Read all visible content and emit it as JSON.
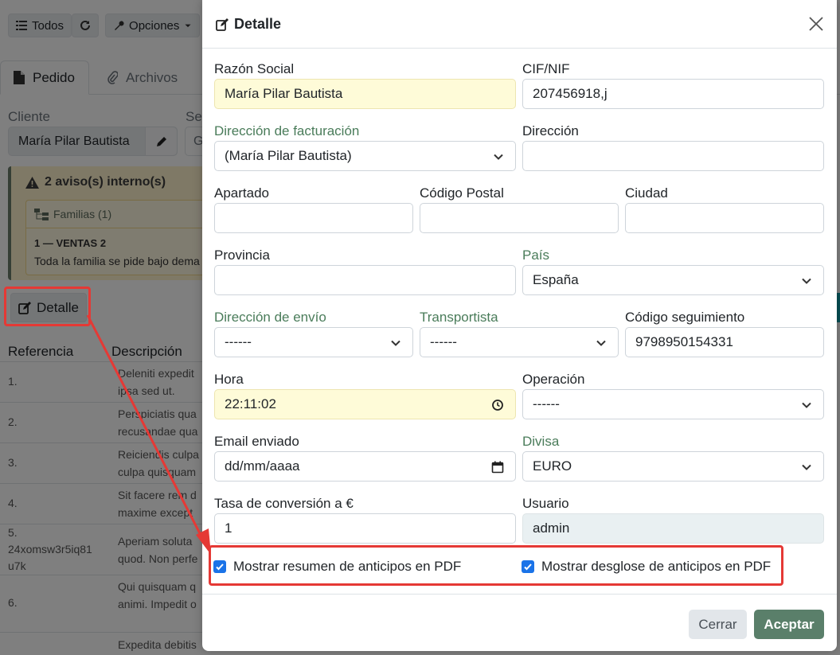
{
  "background": {
    "toolbar": {
      "todos_label": "Todos",
      "opciones_label": "Opciones"
    },
    "tabs": [
      {
        "label": "Pedido"
      },
      {
        "label": "Archivos"
      }
    ],
    "cliente_label": "Cliente",
    "cliente_value": "María Pilar Bautista",
    "se_label": "Se",
    "se_value": "G",
    "alert": {
      "title": "2 aviso(s) interno(s)",
      "familias": "Familias (1)",
      "item": "1 — VENTAS 2",
      "text": "Toda la familia se pide bajo dema"
    },
    "detalle_button": "Detalle",
    "table": {
      "headers": [
        "Referencia",
        "Descripción"
      ],
      "rows": [
        {
          "num": "1.",
          "desc_l1": "Deleniti expedit",
          "desc_l2": "ipsa sed ut."
        },
        {
          "num": "2.",
          "desc_l1": "Perspiciatis qua",
          "desc_l2": "recusandae qua"
        },
        {
          "num": "3.",
          "desc_l1": "Reiciendis culpa",
          "desc_l2": "culpa quisquam"
        },
        {
          "num": "4.",
          "desc_l1": "Sit facere rem d",
          "desc_l2": "maxime except"
        },
        {
          "num": "5.",
          "ref_l2": "24xomsw3r5iq81",
          "ref_l3": "u7k",
          "desc_l1": "Aperiam soluta",
          "desc_l2": "quod. Non perfe"
        },
        {
          "num": "6.",
          "desc_l1": "Qui quisquam q",
          "desc_l2": "animi. Impedit o"
        },
        {
          "num": "",
          "desc_l1": "Expedita debitis",
          "desc_l2": ""
        }
      ]
    }
  },
  "modal": {
    "title": "Detalle",
    "fields": {
      "razon_social": {
        "label": "Razón Social",
        "value": "María Pilar Bautista"
      },
      "cif": {
        "label": "CIF/NIF",
        "value": "207456918,j"
      },
      "dir_facturacion": {
        "label": "Dirección de facturación",
        "value": "(María Pilar Bautista)"
      },
      "direccion": {
        "label": "Dirección",
        "value": ""
      },
      "apartado": {
        "label": "Apartado",
        "value": ""
      },
      "codigo_postal": {
        "label": "Código Postal",
        "value": ""
      },
      "ciudad": {
        "label": "Ciudad",
        "value": ""
      },
      "provincia": {
        "label": "Provincia",
        "value": ""
      },
      "pais": {
        "label": "País",
        "value": "España"
      },
      "dir_envio": {
        "label": "Dirección de envío",
        "value": "------"
      },
      "transportista": {
        "label": "Transportista",
        "value": "------"
      },
      "codigo_seguimiento": {
        "label": "Código seguimiento",
        "value": "9798950154331"
      },
      "hora": {
        "label": "Hora",
        "value": "22:11:02"
      },
      "operacion": {
        "label": "Operación",
        "value": "------"
      },
      "email_enviado": {
        "label": "Email enviado",
        "value": "dd/mm/aaaa"
      },
      "divisa": {
        "label": "Divisa",
        "value": "EURO"
      },
      "tasa": {
        "label": "Tasa de conversión a €",
        "value": "1"
      },
      "usuario": {
        "label": "Usuario",
        "value": "admin"
      }
    },
    "checkboxes": {
      "resumen": {
        "label": "Mostrar resumen de anticipos en PDF",
        "checked": true
      },
      "desglose": {
        "label": "Mostrar desglose de anticipos en PDF",
        "checked": true
      }
    },
    "buttons": {
      "cerrar": "Cerrar",
      "aceptar": "Aceptar"
    }
  },
  "colors": {
    "accent": "#5a7f6a",
    "annotation": "#e53935",
    "checkbox": "#1a73e8",
    "highlight_field": "#fefbd8"
  }
}
